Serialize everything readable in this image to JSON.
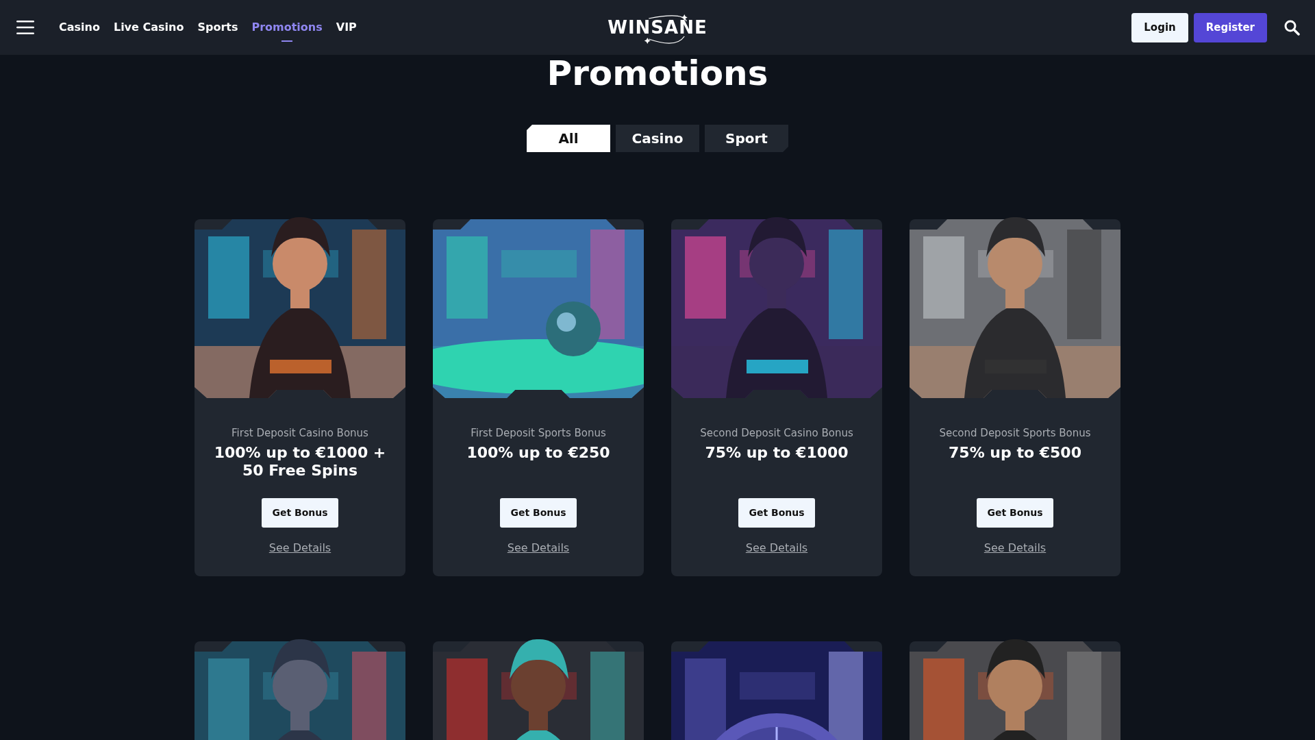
{
  "header": {
    "nav": [
      {
        "label": "Casino",
        "selected": false
      },
      {
        "label": "Live Casino",
        "selected": false
      },
      {
        "label": "Sports",
        "selected": false
      },
      {
        "label": "Promotions",
        "selected": true
      },
      {
        "label": "VIP",
        "selected": false
      }
    ],
    "logo": "WINSANE",
    "buttons": [
      {
        "label": "Login",
        "kind": "light"
      },
      {
        "label": "Register",
        "kind": "primary"
      }
    ]
  },
  "title": "Promotions",
  "tabs": [
    {
      "label": "All",
      "selected": true
    },
    {
      "label": "Casino",
      "selected": false
    },
    {
      "label": "Sport",
      "selected": false
    }
  ],
  "promotions": [
    {
      "picture": {
        "kind": "picture"
      },
      "subtitle": "First Deposit Casino Bonus",
      "title": "100% up to €1000 + 50 Free Spins",
      "button": "Get Bonus",
      "link": "See Details"
    },
    {
      "picture": {
        "kind": "picture"
      },
      "subtitle": "First Deposit Sports Bonus",
      "title": "100% up to €250",
      "button": "Get Bonus",
      "link": "See Details"
    },
    {
      "picture": {
        "kind": "picture"
      },
      "subtitle": "Second Deposit Casino Bonus",
      "title": "75% up to €1000",
      "button": "Get Bonus",
      "link": "See Details"
    },
    {
      "picture": {
        "kind": "picture"
      },
      "subtitle": "Second Deposit Sports Bonus",
      "title": "75% up to €500",
      "button": "Get Bonus",
      "link": "See Details"
    },
    {
      "picture": {
        "kind": "picture"
      }
    },
    {
      "picture": {
        "kind": "picture"
      }
    },
    {
      "picture": {
        "kind": "picture"
      }
    },
    {
      "picture": {
        "kind": "picture"
      }
    }
  ]
}
